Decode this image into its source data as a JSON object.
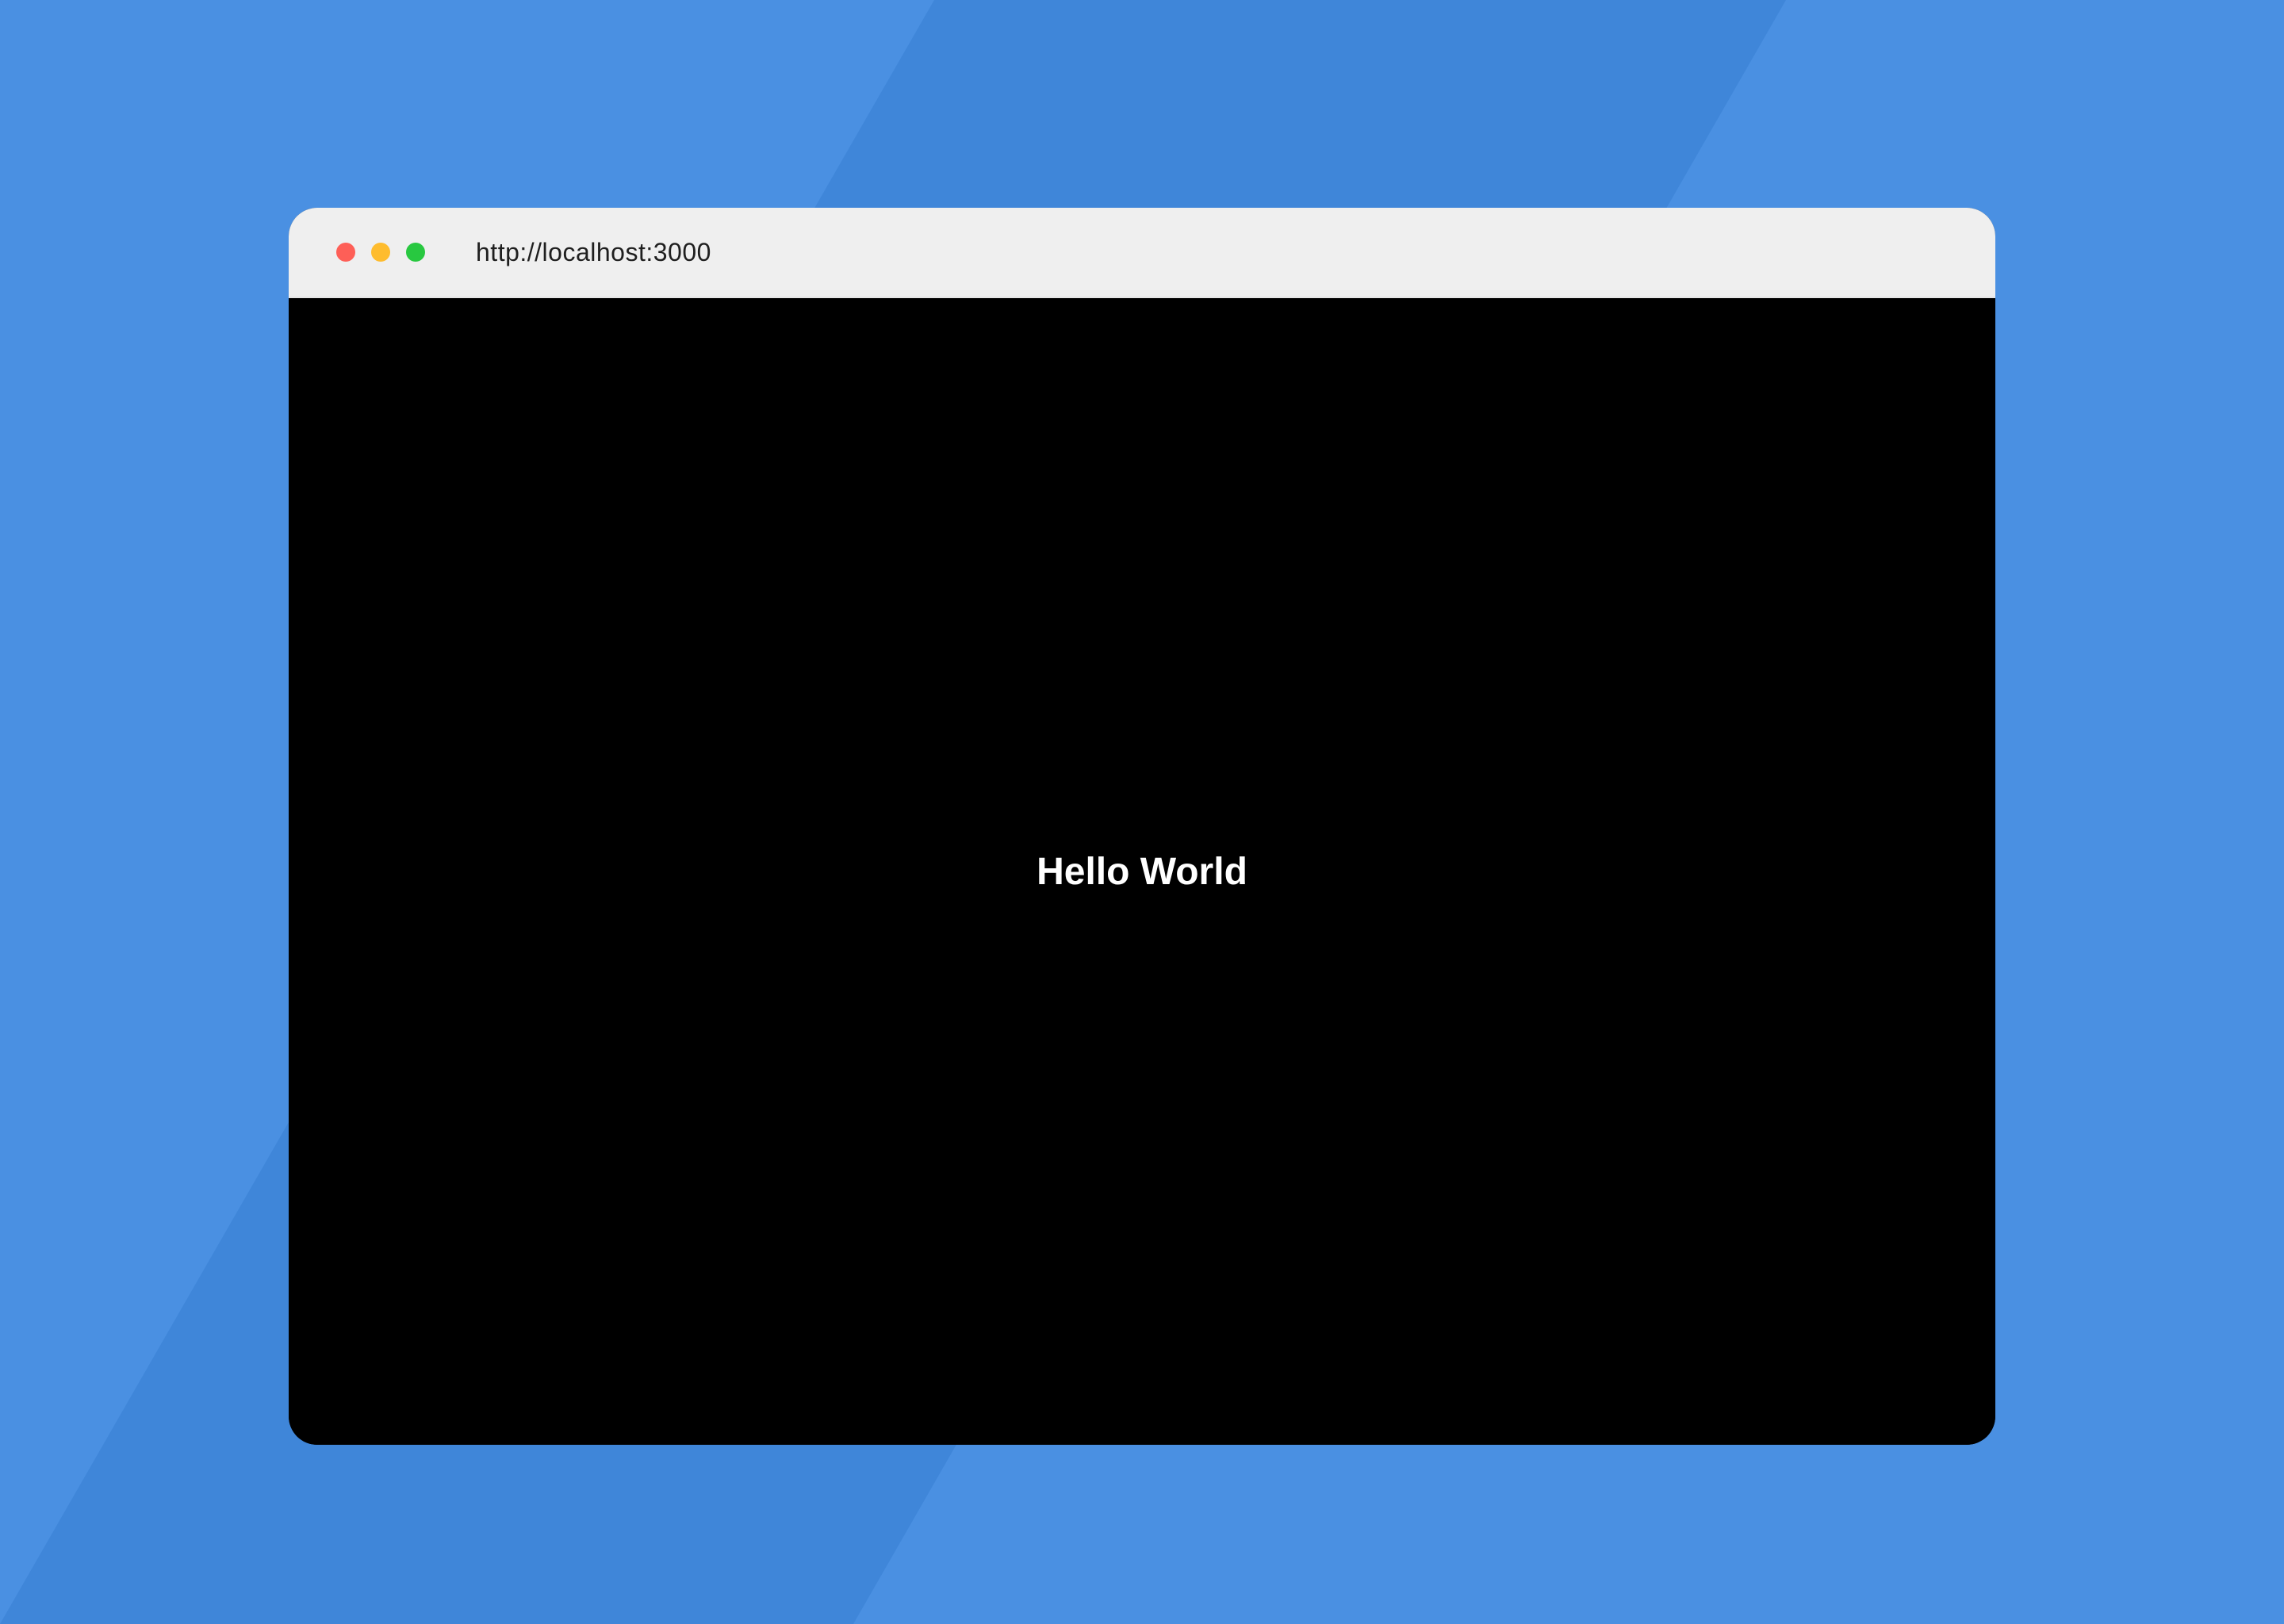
{
  "desktop": {
    "background_color": "#4a90e2",
    "band_color": "#3f86d9"
  },
  "browser": {
    "address": "http://localhost:3000",
    "title_bar_color": "#efefef",
    "controls": [
      {
        "name": "close",
        "color": "#fe5f57"
      },
      {
        "name": "minimize",
        "color": "#febc2e"
      },
      {
        "name": "maximize",
        "color": "#28c840"
      }
    ]
  },
  "page": {
    "background_color": "#000000",
    "heading": "Hello World",
    "heading_color": "#ffffff"
  }
}
